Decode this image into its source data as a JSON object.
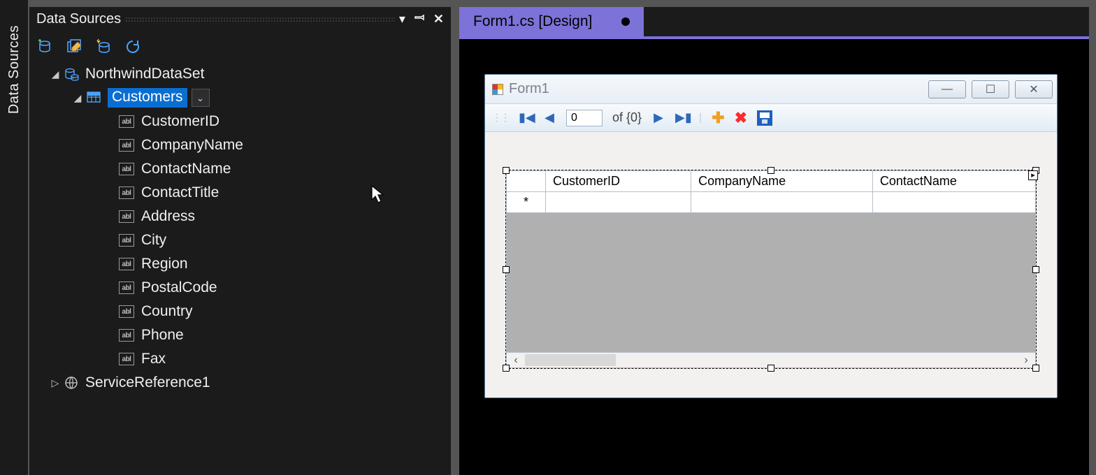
{
  "sidebar": {
    "tab_label": "Data Sources"
  },
  "panel": {
    "title": "Data Sources",
    "toolbar": {
      "add": "add-data-source",
      "edit": "edit-dataset",
      "wizard": "configure-dataset",
      "refresh": "refresh"
    },
    "tree": {
      "root": {
        "label": "NorthwindDataSet",
        "expanded": true
      },
      "customers": {
        "label": "Customers",
        "expanded": true,
        "selected": true,
        "fields": [
          "CustomerID",
          "CompanyName",
          "ContactName",
          "ContactTitle",
          "Address",
          "City",
          "Region",
          "PostalCode",
          "Country",
          "Phone",
          "Fax"
        ]
      },
      "service_ref": {
        "label": "ServiceReference1",
        "expanded": false
      }
    }
  },
  "designer": {
    "tab": {
      "label": "Form1.cs [Design]",
      "dirty": true
    },
    "form": {
      "title": "Form1"
    },
    "binding_nav": {
      "position": "0",
      "total": "of {0}"
    },
    "grid": {
      "columns": [
        "CustomerID",
        "CompanyName",
        "ContactName"
      ],
      "new_row_marker": "*"
    }
  }
}
